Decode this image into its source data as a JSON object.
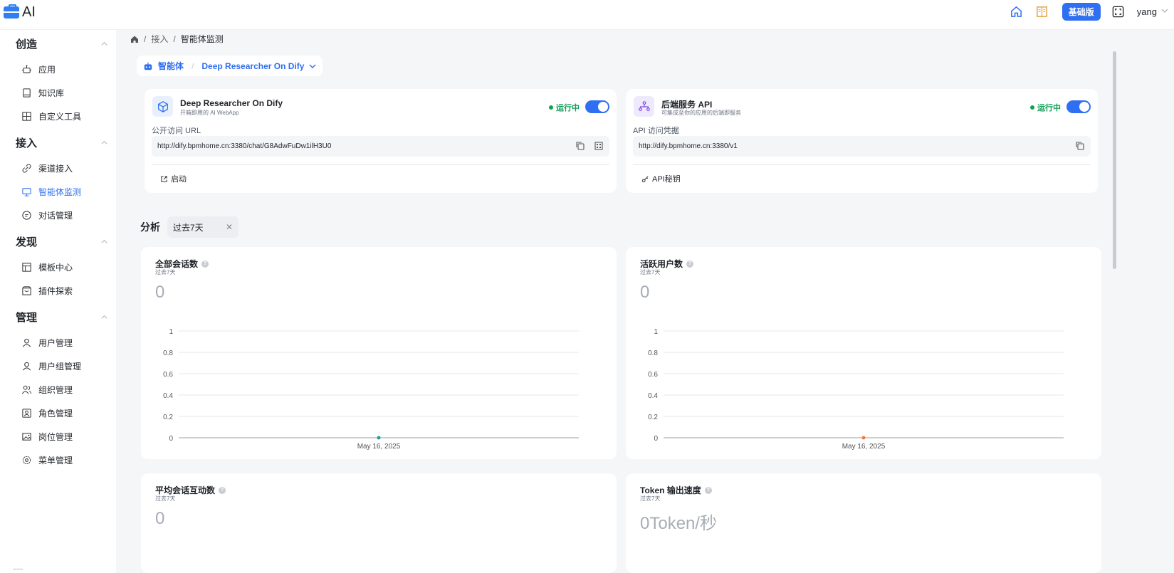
{
  "app": {
    "title": "AI",
    "user": "yang",
    "plan": "基础版"
  },
  "breadcrumb": {
    "item1": "接入",
    "item2": "智能体监测"
  },
  "sidebar": {
    "sections": [
      {
        "title": "创造",
        "items": [
          "应用",
          "知识库",
          "自定义工具"
        ]
      },
      {
        "title": "接入",
        "items": [
          "渠道接入",
          "智能体监测",
          "对话管理"
        ]
      },
      {
        "title": "发现",
        "items": [
          "模板中心",
          "插件探索"
        ]
      },
      {
        "title": "管理",
        "items": [
          "用户管理",
          "用户组管理",
          "组织管理",
          "角色管理",
          "岗位管理",
          "菜单管理"
        ]
      }
    ],
    "active": "智能体监测"
  },
  "agent_selector": {
    "label": "智能体",
    "name": "Deep Researcher On Dify"
  },
  "webapp_card": {
    "title": "Deep Researcher On Dify",
    "subtitle": "开箱即用的 AI WebApp",
    "status": "运行中",
    "field_label": "公开访问 URL",
    "url": "http://dify.bpmhome.cn:3380/chat/G8AdwFuDw1ilH3U0",
    "action": "启动",
    "enabled": true
  },
  "api_card": {
    "title": "后端服务 API",
    "subtitle": "可集成至你的应用的后端即服务",
    "status": "运行中",
    "field_label": "API 访问凭据",
    "url": "http://dify.bpmhome.cn:3380/v1",
    "action": "API秘钥",
    "enabled": true
  },
  "analysis": {
    "title": "分析",
    "period": "过去7天"
  },
  "metrics": [
    {
      "title": "全部会话数",
      "period": "过去7天",
      "value": "0"
    },
    {
      "title": "活跃用户数",
      "period": "过去7天",
      "value": "0"
    },
    {
      "title": "平均会话互动数",
      "period": "过去7天",
      "value": "0"
    },
    {
      "title": "Token 输出速度",
      "period": "过去7天",
      "value": "0Token/秒"
    }
  ],
  "chart_data": [
    {
      "type": "line",
      "x": [
        "May 16, 2025"
      ],
      "series": [
        {
          "values": [
            0
          ]
        }
      ],
      "ylim": [
        0,
        1
      ],
      "yticks": [
        "1",
        "0.8",
        "0.6",
        "0.4",
        "0.2",
        "0"
      ],
      "color": "#1aa39a",
      "grid": true
    },
    {
      "type": "line",
      "x": [
        "May 16, 2025"
      ],
      "series": [
        {
          "values": [
            0
          ]
        }
      ],
      "ylim": [
        0,
        1
      ],
      "yticks": [
        "1",
        "0.8",
        "0.6",
        "0.4",
        "0.2",
        "0"
      ],
      "color": "#f07a4a",
      "grid": true
    }
  ],
  "colors": {
    "accent": "#2f6ff2",
    "running": "#12a150"
  }
}
